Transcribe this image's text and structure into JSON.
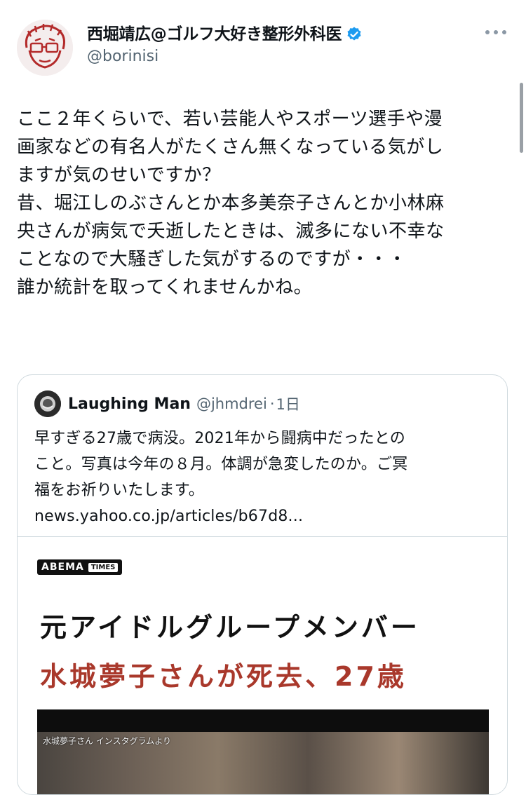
{
  "author": {
    "display_name": "西堀靖広@ゴルフ大好き整形外科医",
    "handle": "@borinisi",
    "avatar_icon": "caricature-avatar-icon",
    "verified_icon": "verified-badge-icon",
    "verified_color": "#1d9bf0"
  },
  "more_icon": "more-options-icon",
  "tweet_text": "ここ２年くらいで、若い芸能人やスポーツ選手や漫\n画家などの有名人がたくさん無くなっている気がし\nますが気のせいですか？\n昔、堀江しのぶさんとか本多美奈子さんとか小林麻\n央さんが病気で夭逝したときは、滅多にない不幸な\nことなので大騒ぎした気がするのですが・・・\n誰か統計を取ってくれませんかね。",
  "quote": {
    "author_name": "Laughing Man",
    "author_handle": "@jhmdrei",
    "separator": "·",
    "time": "1日",
    "text": "早すぎる27歳で病没。2021年から闘病中だったとの\nこと。写真は今年の８月。体調が急変したのか。ご冥\n福をお祈りいたします。\nnews.yahoo.co.jp/articles/b67d8...",
    "card": {
      "logo_word": "ABEMA",
      "logo_times": "TIMES",
      "headline_line1": "元アイドルグループメンバー",
      "headline_line2": "水城夢子さんが死去、27歳",
      "headline2_color": "#a9382b",
      "photo_caption": "水城夢子さん インスタグラムより"
    }
  }
}
